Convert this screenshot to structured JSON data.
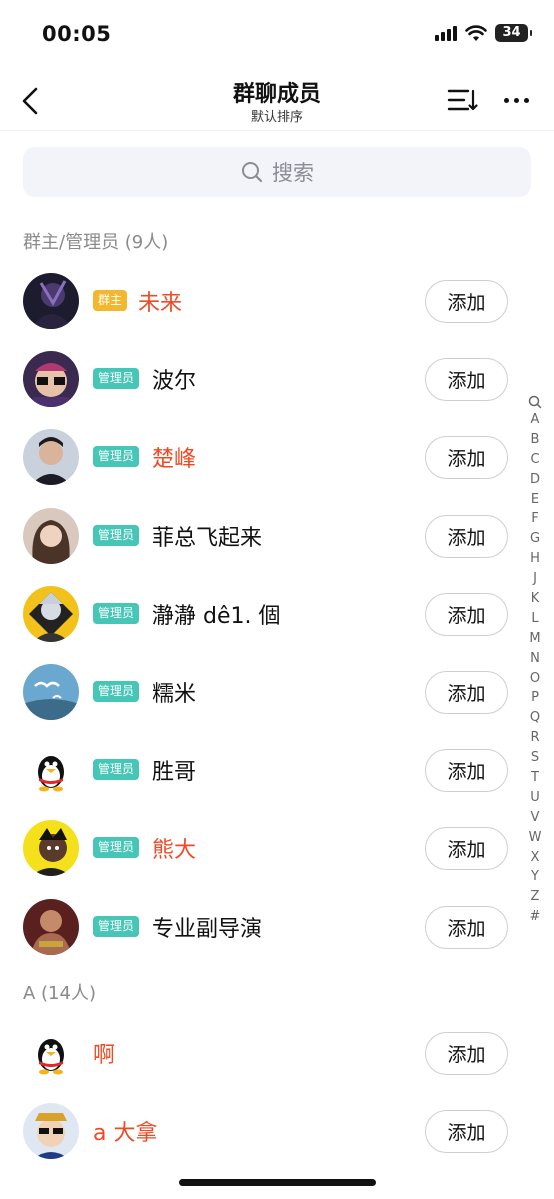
{
  "status_bar": {
    "time": "00:05",
    "battery": "34"
  },
  "nav": {
    "title": "群聊成员",
    "subtitle": "默认排序"
  },
  "search": {
    "placeholder": "搜索"
  },
  "sections": {
    "admins_header": "群主/管理员 (9人)",
    "a_header": "A (14人)"
  },
  "add_label": "添加",
  "colors": {
    "accent_name": "#f04a25",
    "normal_name": "#111111",
    "owner_badge": "#f3b72d",
    "admin_badge": "#45c6b6"
  },
  "members": [
    {
      "badge": "群主",
      "badge_type": "owner",
      "name": "未来",
      "highlight": true,
      "avatar": "dark-anime-avatar"
    },
    {
      "badge": "管理员",
      "badge_type": "admin",
      "name": "波尔",
      "highlight": false,
      "avatar": "cartoon-glasses-avatar"
    },
    {
      "badge": "管理员",
      "badge_type": "admin",
      "name": "楚峰",
      "highlight": true,
      "avatar": "man-photo-avatar"
    },
    {
      "badge": "管理员",
      "badge_type": "admin",
      "name": "菲总飞起来",
      "highlight": false,
      "avatar": "woman-photo-avatar"
    },
    {
      "badge": "管理员",
      "badge_type": "admin",
      "name": "瀞瀞 dê1. 個",
      "highlight": false,
      "avatar": "anime-yellow-avatar"
    },
    {
      "badge": "管理员",
      "badge_type": "admin",
      "name": "糯米",
      "highlight": false,
      "avatar": "seagull-sky-avatar"
    },
    {
      "badge": "管理员",
      "badge_type": "admin",
      "name": "胜哥",
      "highlight": false,
      "avatar": "qq-penguin-avatar"
    },
    {
      "badge": "管理员",
      "badge_type": "admin",
      "name": "熊大",
      "highlight": true,
      "avatar": "yellow-cartoon-avatar"
    },
    {
      "badge": "管理员",
      "badge_type": "admin",
      "name": "专业副导演",
      "highlight": false,
      "avatar": "wrestler-photo-avatar"
    }
  ],
  "a_members": [
    {
      "name": "啊",
      "highlight": true,
      "avatar": "qq-penguin-avatar"
    },
    {
      "name": "a 大拿",
      "highlight": true,
      "avatar": "cartoon-money-avatar"
    }
  ],
  "index_letters": [
    "A",
    "B",
    "C",
    "D",
    "E",
    "F",
    "G",
    "H",
    "J",
    "K",
    "L",
    "M",
    "N",
    "O",
    "P",
    "Q",
    "R",
    "S",
    "T",
    "U",
    "V",
    "W",
    "X",
    "Y",
    "Z",
    "#"
  ]
}
